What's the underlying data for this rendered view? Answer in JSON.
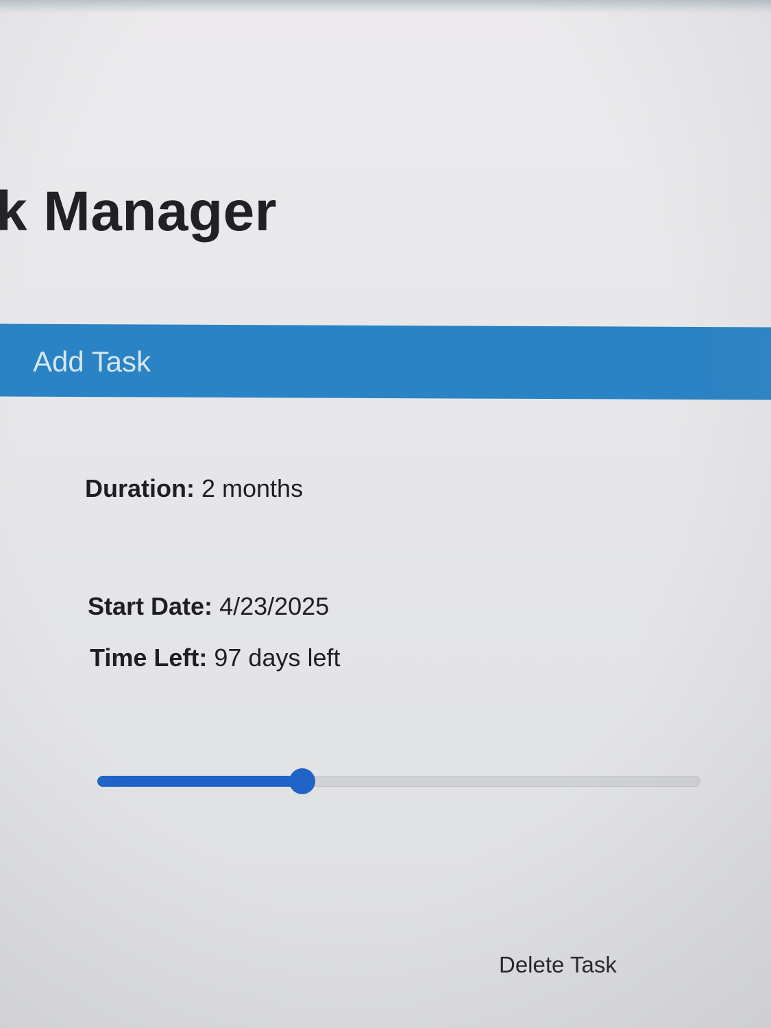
{
  "header": {
    "title": "k Manager",
    "add_task_label": "Add Task",
    "bar_color": "#2a83c4"
  },
  "task": {
    "duration_label": "Duration:",
    "duration_value": "2 months",
    "start_date_label": "Start Date:",
    "start_date_value": "4/23/2025",
    "time_left_label": "Time Left:",
    "time_left_value": "97 days left",
    "progress_fraction": 0.34,
    "progress_color": "#1f63c6",
    "delete_label": "Delete Task"
  }
}
